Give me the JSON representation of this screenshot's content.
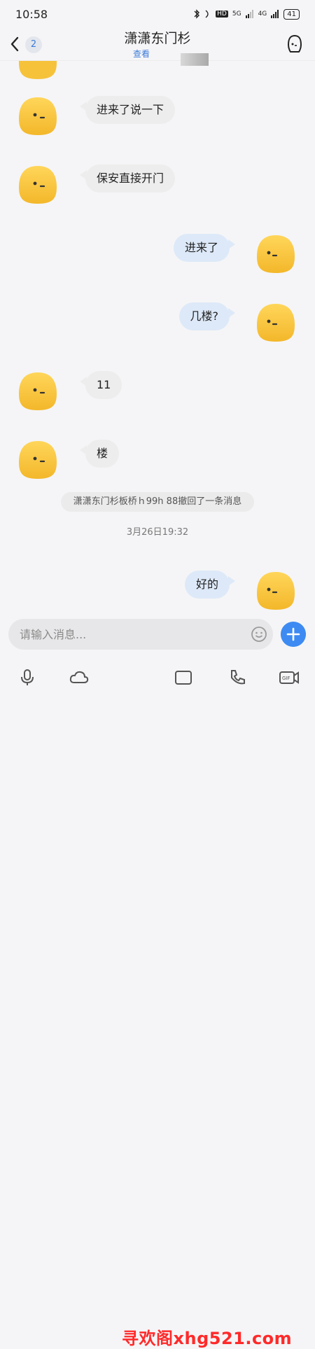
{
  "status_bar": {
    "time": "10:58",
    "network_labels": [
      "HD",
      "5G",
      "4G"
    ],
    "battery": "41"
  },
  "header": {
    "unread_count": "2",
    "title": "潇潇东门杉",
    "subtitle": "查看"
  },
  "messages": [
    {
      "side": "in",
      "text": "进来了说一下"
    },
    {
      "side": "in",
      "text": "保安直接开门"
    },
    {
      "side": "out",
      "text": "进来了"
    },
    {
      "side": "out",
      "text": "几楼?"
    },
    {
      "side": "in",
      "text": "11"
    },
    {
      "side": "in",
      "text": "楼"
    },
    {
      "side": "out",
      "text": "好的"
    }
  ],
  "system_notice": "潇潇东门杉板桥ｈ99h 88撤回了一条消息",
  "timestamp": "3月26日19:32",
  "input": {
    "placeholder": "请输入消息...",
    "value": ""
  },
  "toolbar": {
    "icons": [
      "mic-icon",
      "cloud-icon",
      "image-icon",
      "voice-call-icon",
      "gif-icon"
    ],
    "gif_label": "GIF"
  },
  "watermark": "寻欢阁xhg521.com",
  "colors": {
    "accent_blue": "#3d8bf2",
    "outgoing_bubble": "#dde9f8",
    "incoming_bubble": "#ededed",
    "avatar_yellow": "#f6c23a",
    "watermark_red": "#ff2a2a"
  }
}
